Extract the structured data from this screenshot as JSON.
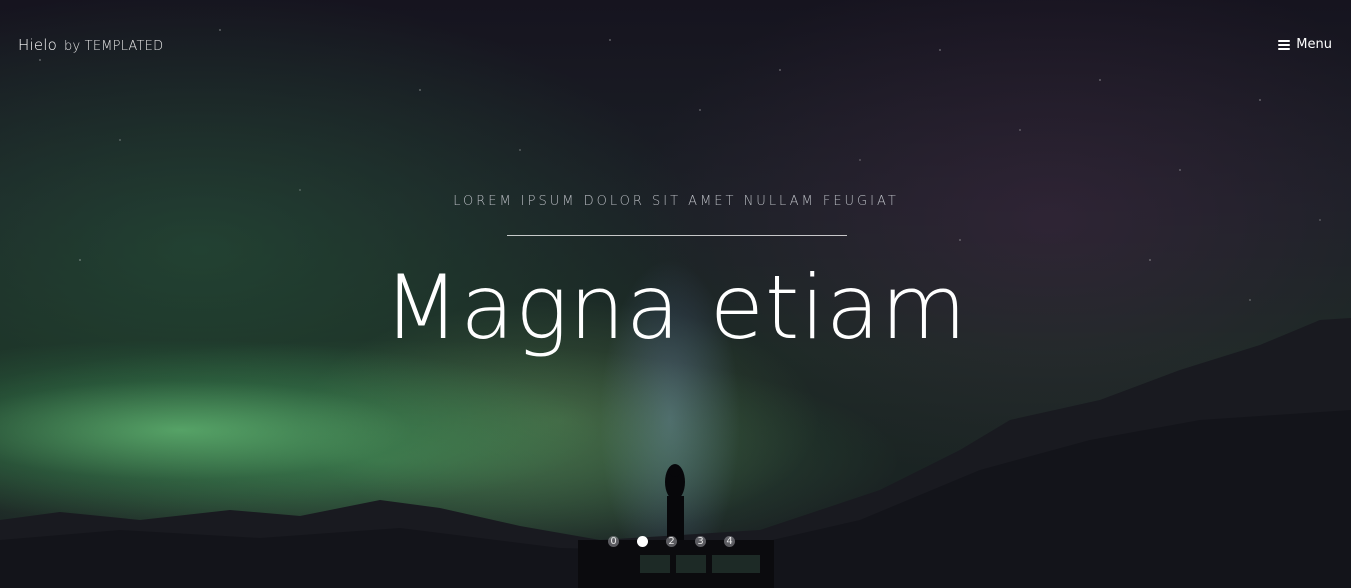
{
  "header": {
    "logo_name": "Hielo",
    "logo_by": "by TEMPLATED",
    "menu_label": "Menu",
    "menu_icon": "hamburger-icon"
  },
  "hero": {
    "kicker": "LOREM IPSUM DOLOR SIT AMET NULLAM FEUGIAT",
    "headline": "Magna etiam"
  },
  "slider": {
    "dots": [
      "0",
      "1",
      "2",
      "3",
      "4"
    ],
    "active_index": 1
  },
  "colors": {
    "text": "#ffffff",
    "kicker": "#b9bcc2",
    "aurora": "#6fdc82"
  }
}
